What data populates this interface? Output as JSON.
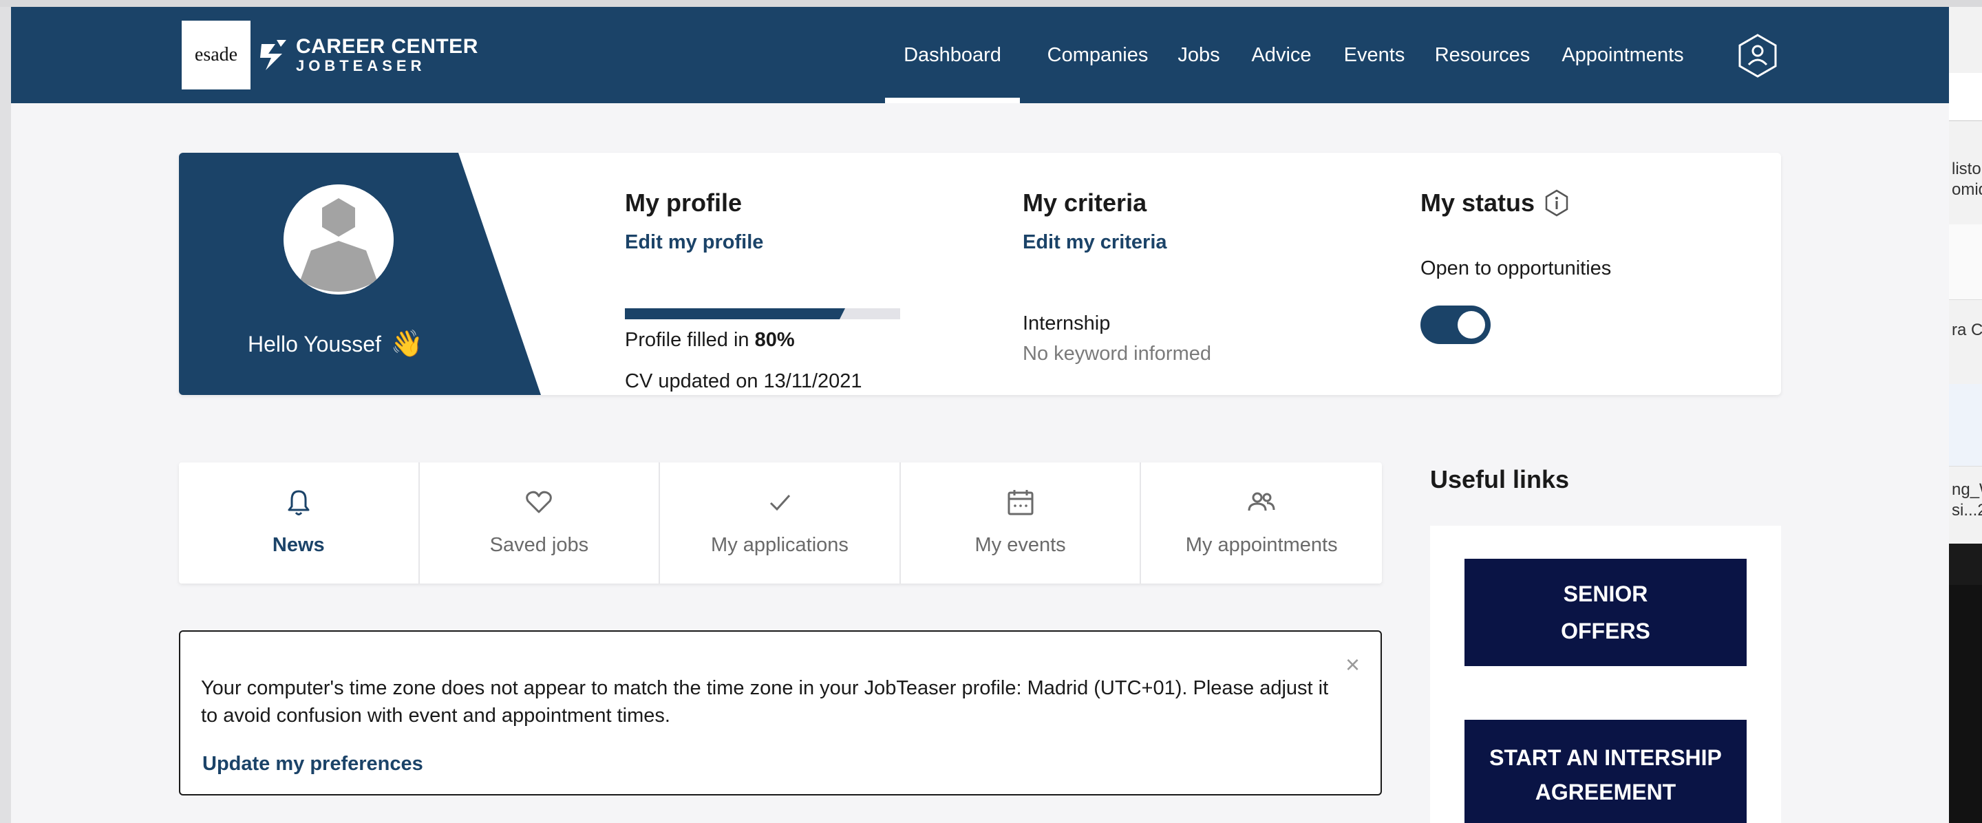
{
  "header": {
    "logo_text": "esade",
    "brand_line1": "CAREER CENTER",
    "brand_line2": "JOBTEASER",
    "nav": [
      {
        "label": "Dashboard",
        "active": true
      },
      {
        "label": "Companies",
        "active": false
      },
      {
        "label": "Jobs",
        "active": false
      },
      {
        "label": "Advice",
        "active": false
      },
      {
        "label": "Events",
        "active": false
      },
      {
        "label": "Resources",
        "active": false
      },
      {
        "label": "Appointments",
        "active": false
      }
    ],
    "account_icon": "user-hexagon-icon"
  },
  "profile": {
    "greeting": "Hello Youssef",
    "greeting_emoji": "👋",
    "my_profile_title": "My profile",
    "edit_profile_link": "Edit my profile",
    "profile_filled_prefix": "Profile filled in ",
    "profile_filled_value": "80%",
    "profile_fill_fraction": 0.8,
    "cv_updated": "CV updated on 13/11/2021",
    "criteria_title": "My criteria",
    "edit_criteria_link": "Edit my criteria",
    "criteria_type": "Internship",
    "criteria_keyword": "No keyword informed",
    "status_title": "My status",
    "status_text": "Open to opportunities",
    "status_on": true
  },
  "tabs": [
    {
      "label": "News",
      "icon": "bell-icon",
      "active": true
    },
    {
      "label": "Saved jobs",
      "icon": "heart-icon",
      "active": false
    },
    {
      "label": "My applications",
      "icon": "check-icon",
      "active": false
    },
    {
      "label": "My events",
      "icon": "calendar-icon",
      "active": false
    },
    {
      "label": "My appointments",
      "icon": "people-icon",
      "active": false
    }
  ],
  "notice": {
    "message": "Your computer's time zone does not appear to match the time zone in your JobTeaser profile: Madrid (UTC+01). Please adjust it to avoid confusion with event and appointment times.",
    "link": "Update my preferences",
    "close_symbol": "×"
  },
  "useful_links": {
    "title": "Useful links",
    "items": [
      {
        "line1": "SENIOR",
        "line2": "OFFERS"
      },
      {
        "line1": "START AN INTERSHIP",
        "line2": "AGREEMENT"
      }
    ]
  },
  "background_window": {
    "fragments": [
      "listo",
      "omiq",
      "ra C",
      "ng_W",
      "si...2"
    ]
  },
  "colors": {
    "brand_navy": "#1b4368",
    "button_navy": "#0a1445",
    "page_bg": "#f5f5f7"
  }
}
